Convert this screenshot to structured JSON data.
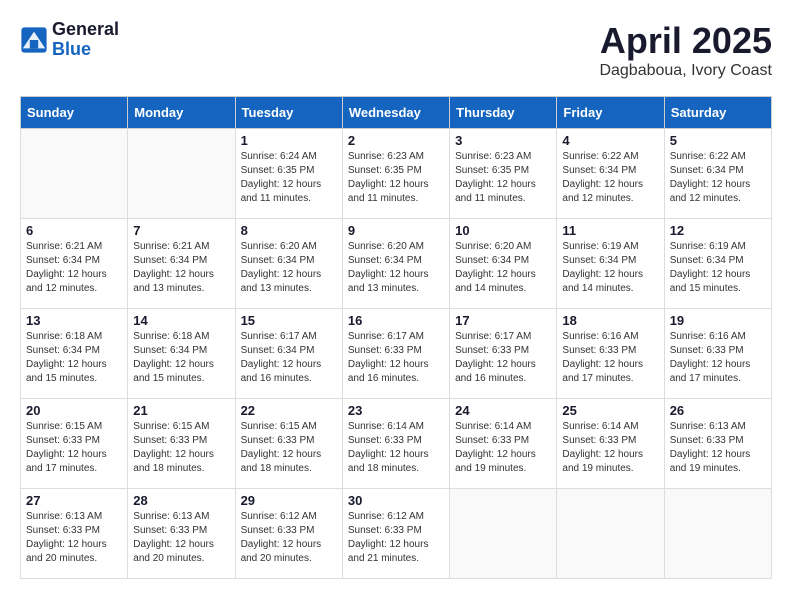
{
  "logo": {
    "general": "General",
    "blue": "Blue"
  },
  "title": "April 2025",
  "location": "Dagbaboua, Ivory Coast",
  "days_header": [
    "Sunday",
    "Monday",
    "Tuesday",
    "Wednesday",
    "Thursday",
    "Friday",
    "Saturday"
  ],
  "weeks": [
    [
      {
        "day": "",
        "info": ""
      },
      {
        "day": "",
        "info": ""
      },
      {
        "day": "1",
        "info": "Sunrise: 6:24 AM\nSunset: 6:35 PM\nDaylight: 12 hours\nand 11 minutes."
      },
      {
        "day": "2",
        "info": "Sunrise: 6:23 AM\nSunset: 6:35 PM\nDaylight: 12 hours\nand 11 minutes."
      },
      {
        "day": "3",
        "info": "Sunrise: 6:23 AM\nSunset: 6:35 PM\nDaylight: 12 hours\nand 11 minutes."
      },
      {
        "day": "4",
        "info": "Sunrise: 6:22 AM\nSunset: 6:34 PM\nDaylight: 12 hours\nand 12 minutes."
      },
      {
        "day": "5",
        "info": "Sunrise: 6:22 AM\nSunset: 6:34 PM\nDaylight: 12 hours\nand 12 minutes."
      }
    ],
    [
      {
        "day": "6",
        "info": "Sunrise: 6:21 AM\nSunset: 6:34 PM\nDaylight: 12 hours\nand 12 minutes."
      },
      {
        "day": "7",
        "info": "Sunrise: 6:21 AM\nSunset: 6:34 PM\nDaylight: 12 hours\nand 13 minutes."
      },
      {
        "day": "8",
        "info": "Sunrise: 6:20 AM\nSunset: 6:34 PM\nDaylight: 12 hours\nand 13 minutes."
      },
      {
        "day": "9",
        "info": "Sunrise: 6:20 AM\nSunset: 6:34 PM\nDaylight: 12 hours\nand 13 minutes."
      },
      {
        "day": "10",
        "info": "Sunrise: 6:20 AM\nSunset: 6:34 PM\nDaylight: 12 hours\nand 14 minutes."
      },
      {
        "day": "11",
        "info": "Sunrise: 6:19 AM\nSunset: 6:34 PM\nDaylight: 12 hours\nand 14 minutes."
      },
      {
        "day": "12",
        "info": "Sunrise: 6:19 AM\nSunset: 6:34 PM\nDaylight: 12 hours\nand 15 minutes."
      }
    ],
    [
      {
        "day": "13",
        "info": "Sunrise: 6:18 AM\nSunset: 6:34 PM\nDaylight: 12 hours\nand 15 minutes."
      },
      {
        "day": "14",
        "info": "Sunrise: 6:18 AM\nSunset: 6:34 PM\nDaylight: 12 hours\nand 15 minutes."
      },
      {
        "day": "15",
        "info": "Sunrise: 6:17 AM\nSunset: 6:34 PM\nDaylight: 12 hours\nand 16 minutes."
      },
      {
        "day": "16",
        "info": "Sunrise: 6:17 AM\nSunset: 6:33 PM\nDaylight: 12 hours\nand 16 minutes."
      },
      {
        "day": "17",
        "info": "Sunrise: 6:17 AM\nSunset: 6:33 PM\nDaylight: 12 hours\nand 16 minutes."
      },
      {
        "day": "18",
        "info": "Sunrise: 6:16 AM\nSunset: 6:33 PM\nDaylight: 12 hours\nand 17 minutes."
      },
      {
        "day": "19",
        "info": "Sunrise: 6:16 AM\nSunset: 6:33 PM\nDaylight: 12 hours\nand 17 minutes."
      }
    ],
    [
      {
        "day": "20",
        "info": "Sunrise: 6:15 AM\nSunset: 6:33 PM\nDaylight: 12 hours\nand 17 minutes."
      },
      {
        "day": "21",
        "info": "Sunrise: 6:15 AM\nSunset: 6:33 PM\nDaylight: 12 hours\nand 18 minutes."
      },
      {
        "day": "22",
        "info": "Sunrise: 6:15 AM\nSunset: 6:33 PM\nDaylight: 12 hours\nand 18 minutes."
      },
      {
        "day": "23",
        "info": "Sunrise: 6:14 AM\nSunset: 6:33 PM\nDaylight: 12 hours\nand 18 minutes."
      },
      {
        "day": "24",
        "info": "Sunrise: 6:14 AM\nSunset: 6:33 PM\nDaylight: 12 hours\nand 19 minutes."
      },
      {
        "day": "25",
        "info": "Sunrise: 6:14 AM\nSunset: 6:33 PM\nDaylight: 12 hours\nand 19 minutes."
      },
      {
        "day": "26",
        "info": "Sunrise: 6:13 AM\nSunset: 6:33 PM\nDaylight: 12 hours\nand 19 minutes."
      }
    ],
    [
      {
        "day": "27",
        "info": "Sunrise: 6:13 AM\nSunset: 6:33 PM\nDaylight: 12 hours\nand 20 minutes."
      },
      {
        "day": "28",
        "info": "Sunrise: 6:13 AM\nSunset: 6:33 PM\nDaylight: 12 hours\nand 20 minutes."
      },
      {
        "day": "29",
        "info": "Sunrise: 6:12 AM\nSunset: 6:33 PM\nDaylight: 12 hours\nand 20 minutes."
      },
      {
        "day": "30",
        "info": "Sunrise: 6:12 AM\nSunset: 6:33 PM\nDaylight: 12 hours\nand 21 minutes."
      },
      {
        "day": "",
        "info": ""
      },
      {
        "day": "",
        "info": ""
      },
      {
        "day": "",
        "info": ""
      }
    ]
  ]
}
